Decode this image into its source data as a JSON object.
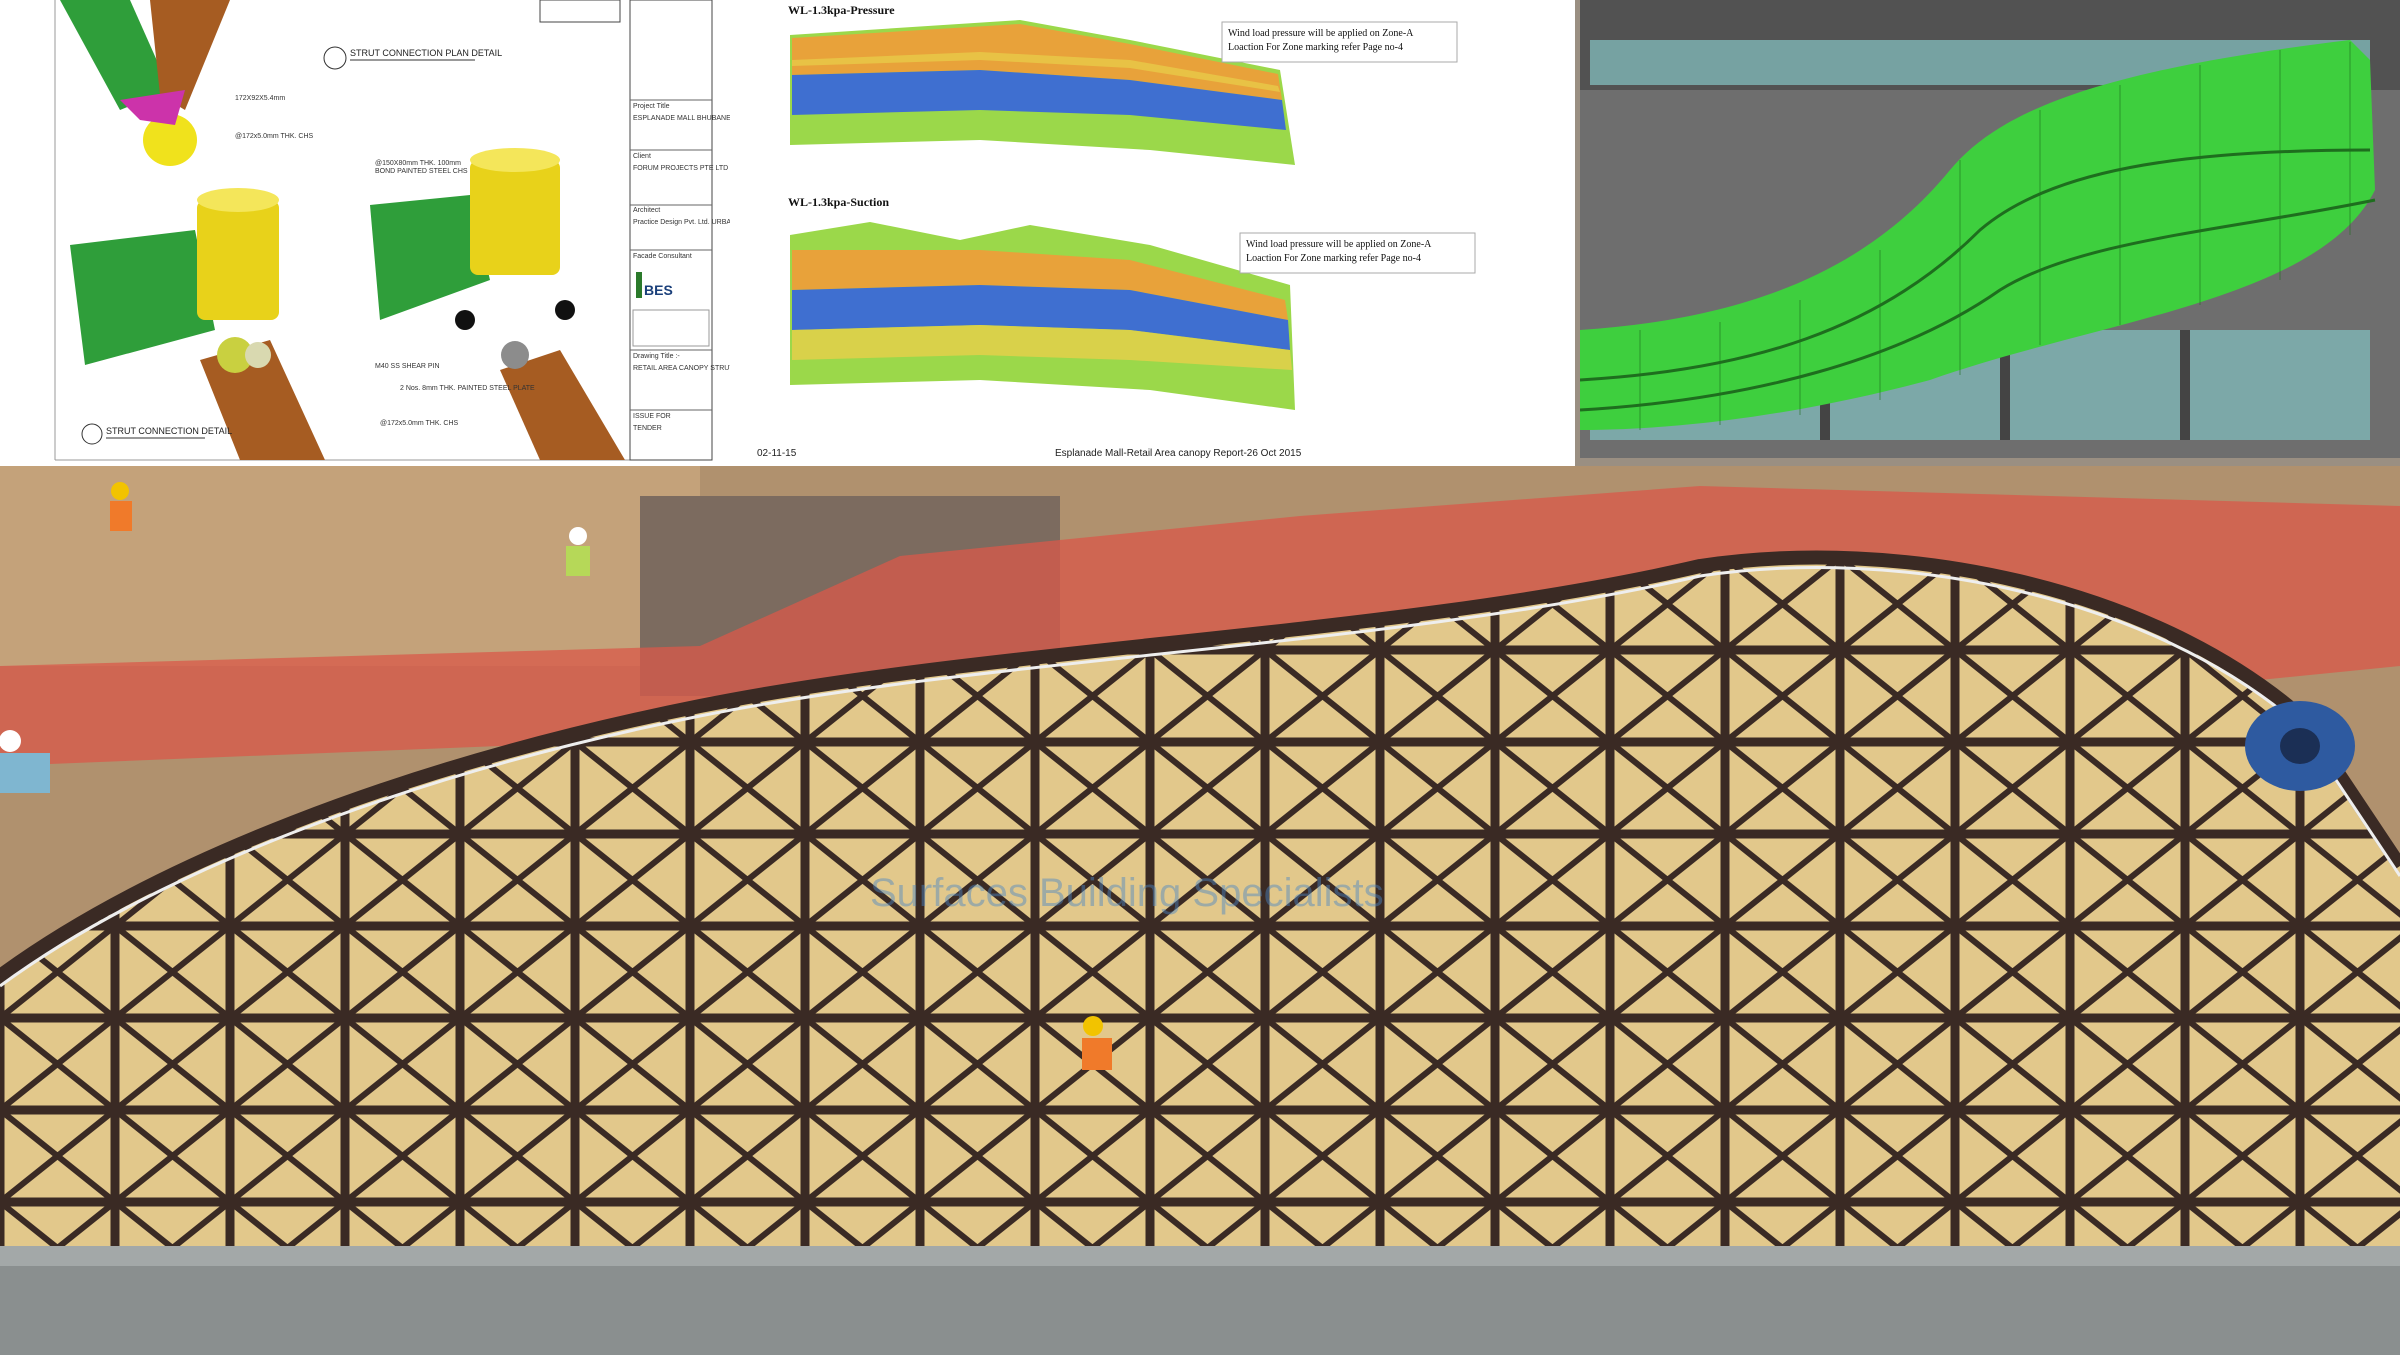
{
  "drawing": {
    "plan_detail_title": "STRUT CONNECTION PLAN DETAIL",
    "connection_detail_title": "STRUT CONNECTION DETAIL",
    "callouts": [
      "172X92X5.4mm",
      "@172x5.0mm THK. CHS",
      "@150X80mm THK. 100mm",
      "BOND PAINTED STEEL CHS",
      "M40 SS SHEAR PIN",
      "2 Nos. 8mm THK. PAINTED STEEL PLATE",
      "@172x5.0mm THK. CHS"
    ],
    "title_block": {
      "project_title_label": "Project Title",
      "project_title": "ESPLANADE MALL BHUBANESWAR",
      "client_label": "Client",
      "client": "FORUM PROJECTS PTE LTD",
      "architect_label": "Architect",
      "architect": "Practice Design Pvt. Ltd. URBANDESK + ARCHITECTURE",
      "facade_label": "Facade Consultant",
      "facade_logo": "BES",
      "drawing_title_label": "Drawing Title :-",
      "drawing_title": "RETAIL AREA CANOPY STRUT CONNECTION DETAIL",
      "issue_label": "ISSUE FOR",
      "issue": "TENDER"
    }
  },
  "analysis": {
    "pressure_title": "WL-1.3kpa-Pressure",
    "suction_title": "WL-1.3kpa-Suction",
    "pressure_note": [
      "Wind load pressure will be applied on Zone-A",
      "Loaction For Zone marking refer Page no-4"
    ],
    "suction_note": [
      "Wind load pressure will be applied on Zone-A",
      "Loaction For Zone marking refer Page no-4"
    ],
    "footer_date": "02-11-15",
    "footer_report": "Esplanade Mall-Retail Area canopy Report-26 Oct 2015",
    "colors": {
      "orange": "#e8a23a",
      "blue": "#3f6fd0",
      "green": "#9bd84a",
      "yellow": "#e8d04a"
    }
  },
  "model": {
    "surface_color": "#3ecf3e",
    "mesh_color": "#1e6e1e"
  },
  "photo": {
    "watermark": "Surfaces Building Specialists",
    "frame_color": "#3a2a24",
    "safety_net_color": "#d9584a"
  }
}
